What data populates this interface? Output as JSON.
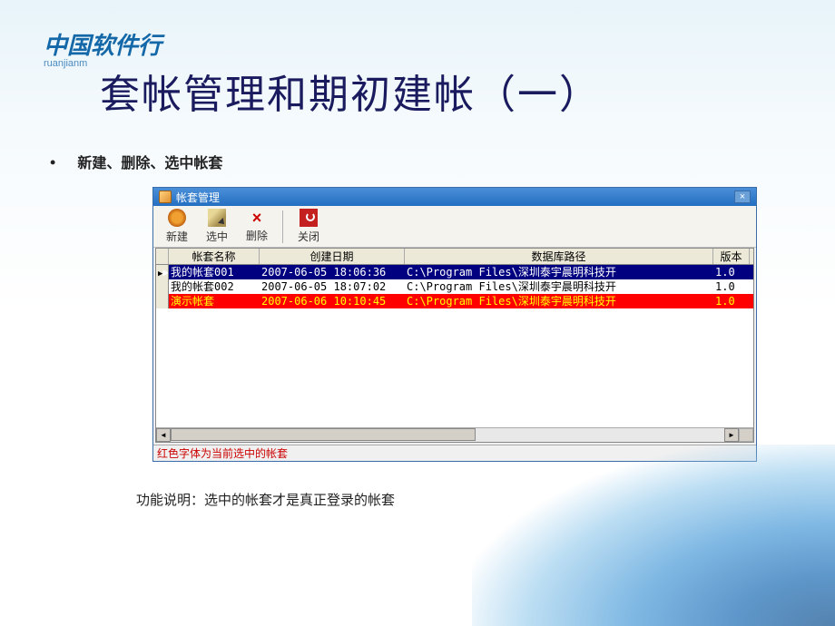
{
  "brand": {
    "title": "中国软件行",
    "sub": "ruanjianm"
  },
  "slide": {
    "title": "套帐管理和期初建帐（一）",
    "bullet": "新建、删除、选中帐套",
    "footnote": "功能说明：选中的帐套才是真正登录的帐套"
  },
  "window": {
    "title": "帐套管理",
    "toolbar": {
      "new": "新建",
      "select": "选中",
      "delete": "删除",
      "close": "关闭"
    },
    "columns": {
      "name": "帐套名称",
      "date": "创建日期",
      "path": "数据库路径",
      "version": "版本"
    },
    "rows": [
      {
        "ind": "▶",
        "name": "我的帐套001",
        "date": "2007-06-05 18:06:36",
        "path": "C:\\Program Files\\深圳泰宇晨明科技开",
        "ver": "1.0",
        "state": "sel"
      },
      {
        "ind": "",
        "name": "我的帐套002",
        "date": "2007-06-05 18:07:02",
        "path": "C:\\Program Files\\深圳泰宇晨明科技开",
        "ver": "1.0",
        "state": "norm"
      },
      {
        "ind": "",
        "name": "演示帐套",
        "date": "2007-06-06 10:10:45",
        "path": "C:\\Program Files\\深圳泰宇晨明科技开",
        "ver": "1.0",
        "state": "red"
      }
    ],
    "status": "红色字体为当前选中的帐套"
  }
}
